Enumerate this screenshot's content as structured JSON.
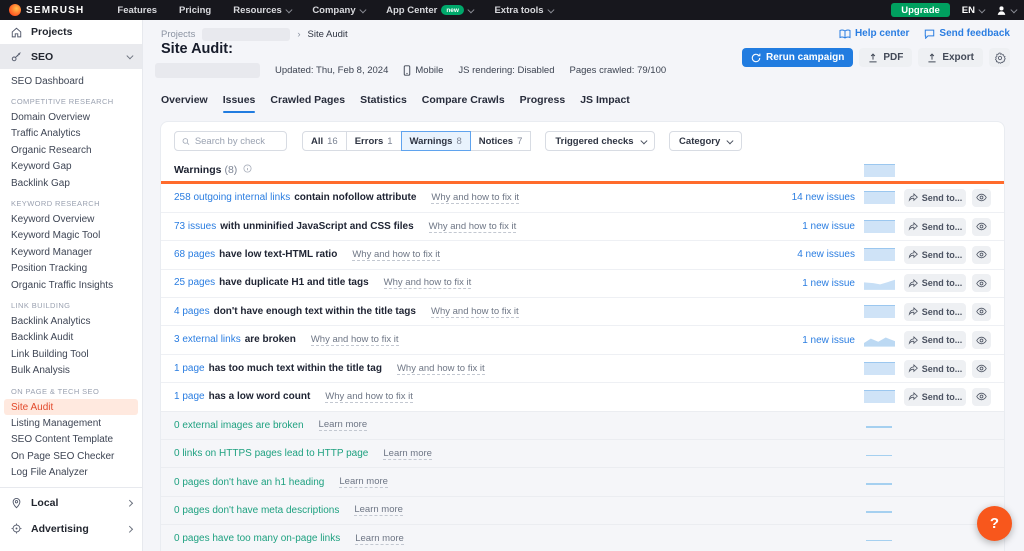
{
  "topnav": {
    "brand": "SEMRUSH",
    "items": [
      {
        "label": "Features"
      },
      {
        "label": "Pricing"
      },
      {
        "label": "Resources",
        "chevron": true
      },
      {
        "label": "Company",
        "chevron": true
      },
      {
        "label": "App Center",
        "badge": "new",
        "chevron": true
      },
      {
        "label": "Extra tools",
        "chevron": true
      }
    ],
    "upgrade_label": "Upgrade",
    "language": "EN"
  },
  "sidebar": {
    "projects_label": "Projects",
    "seo_label": "SEO",
    "entries": [
      {
        "type": "item",
        "label": "SEO Dashboard",
        "interactable": "true"
      },
      {
        "type": "header",
        "label": "COMPETITIVE RESEARCH",
        "interactable": "false"
      },
      {
        "type": "item",
        "label": "Domain Overview",
        "interactable": "true"
      },
      {
        "type": "item",
        "label": "Traffic Analytics",
        "interactable": "true"
      },
      {
        "type": "item",
        "label": "Organic Research",
        "interactable": "true"
      },
      {
        "type": "item",
        "label": "Keyword Gap",
        "interactable": "true"
      },
      {
        "type": "item",
        "label": "Backlink Gap",
        "interactable": "true"
      },
      {
        "type": "header",
        "label": "KEYWORD RESEARCH",
        "interactable": "false"
      },
      {
        "type": "item",
        "label": "Keyword Overview",
        "interactable": "true"
      },
      {
        "type": "item",
        "label": "Keyword Magic Tool",
        "interactable": "true"
      },
      {
        "type": "item",
        "label": "Keyword Manager",
        "interactable": "true"
      },
      {
        "type": "item",
        "label": "Position Tracking",
        "interactable": "true"
      },
      {
        "type": "item",
        "label": "Organic Traffic Insights",
        "interactable": "true"
      },
      {
        "type": "header",
        "label": "LINK BUILDING",
        "interactable": "false"
      },
      {
        "type": "item",
        "label": "Backlink Analytics",
        "interactable": "true"
      },
      {
        "type": "item",
        "label": "Backlink Audit",
        "interactable": "true"
      },
      {
        "type": "item",
        "label": "Link Building Tool",
        "interactable": "true"
      },
      {
        "type": "item",
        "label": "Bulk Analysis",
        "interactable": "true"
      },
      {
        "type": "header",
        "label": "ON PAGE & TECH SEO",
        "interactable": "false"
      },
      {
        "type": "item",
        "label": "Site Audit",
        "state": "active",
        "interactable": "true"
      },
      {
        "type": "item",
        "label": "Listing Management",
        "interactable": "true"
      },
      {
        "type": "item",
        "label": "SEO Content Template",
        "interactable": "true"
      },
      {
        "type": "item",
        "label": "On Page SEO Checker",
        "interactable": "true"
      },
      {
        "type": "item",
        "label": "Log File Analyzer",
        "interactable": "true"
      }
    ],
    "local_label": "Local",
    "advertising_label": "Advertising"
  },
  "header": {
    "breadcrumb_root": "Projects",
    "breadcrumb_sep": "›",
    "breadcrumb_current": "Site Audit",
    "title": "Site Audit:",
    "updated": "Updated: Thu, Feb 8, 2024",
    "device": "Mobile",
    "js_rendering": "JS rendering: Disabled",
    "pages_crawled": "Pages crawled: 79/100",
    "help_label": "Help center",
    "feedback_label": "Send feedback",
    "rerun_label": "Rerun campaign",
    "pdf_label": "PDF",
    "export_label": "Export"
  },
  "tabs": [
    {
      "label": "Overview"
    },
    {
      "label": "Issues",
      "state": "active"
    },
    {
      "label": "Crawled Pages"
    },
    {
      "label": "Statistics"
    },
    {
      "label": "Compare Crawls"
    },
    {
      "label": "Progress"
    },
    {
      "label": "JS Impact"
    }
  ],
  "filters": {
    "search_placeholder": "Search by check",
    "segments": [
      {
        "label": "All",
        "count": "16"
      },
      {
        "label": "Errors",
        "count": "1"
      },
      {
        "label": "Warnings",
        "count": "8",
        "state": "active"
      },
      {
        "label": "Notices",
        "count": "7"
      }
    ],
    "triggered_label": "Triggered checks",
    "category_label": "Category"
  },
  "warnings": {
    "title": "Warnings",
    "count": "(8)",
    "send_label": "Send to...",
    "rows": [
      {
        "link": "258 outgoing internal links",
        "rest": "contain nofollow attribute",
        "fix": "Why and how to fix it",
        "new_issues": "14 new issues",
        "spark": "flat"
      },
      {
        "link": "73 issues",
        "rest": "with unminified JavaScript and CSS files",
        "fix": "Why and how to fix it",
        "new_issues": "1 new issue",
        "spark": "flat"
      },
      {
        "link": "68 pages",
        "rest": "have low text-HTML ratio",
        "fix": "Why and how to fix it",
        "new_issues": "4 new issues",
        "spark": "flat"
      },
      {
        "link": "25 pages",
        "rest": "have duplicate H1 and title tags",
        "fix": "Why and how to fix it",
        "new_issues": "1 new issue",
        "spark": "dip"
      },
      {
        "link": "4 pages",
        "rest": "don't have enough text within the title tags",
        "fix": "Why and how to fix it",
        "new_issues": "",
        "spark": "flat"
      },
      {
        "link": "3 external links",
        "rest": "are broken",
        "fix": "Why and how to fix it",
        "new_issues": "1 new issue",
        "spark": "zigzag"
      },
      {
        "link": "1 page",
        "rest": "has too much text within the title tag",
        "fix": "Why and how to fix it",
        "new_issues": "",
        "spark": "flat"
      },
      {
        "link": "1 page",
        "rest": "has a low word count",
        "fix": "Why and how to fix it",
        "new_issues": "",
        "spark": "flat"
      }
    ],
    "zero_rows": [
      {
        "text": "0 external images are broken",
        "more": "Learn more"
      },
      {
        "text": "0 links on HTTPS pages lead to HTTP page",
        "more": "Learn more"
      },
      {
        "text": "0 pages don't have an h1 heading",
        "more": "Learn more"
      },
      {
        "text": "0 pages don't have meta descriptions",
        "more": "Learn more"
      },
      {
        "text": "0 pages have too many on-page links",
        "more": "Learn more"
      }
    ]
  },
  "help_fab": "?",
  "colors": {
    "brand_orange": "#ff5b2d",
    "accent_blue": "#217ce0",
    "link_blue": "#2a7de1",
    "upgrade_green": "#00a05f",
    "warning_orange": "#ff6b2c",
    "success_teal": "#1ea180",
    "active_sidebar_text": "#e2492b",
    "active_sidebar_bg": "#ffe9df"
  }
}
